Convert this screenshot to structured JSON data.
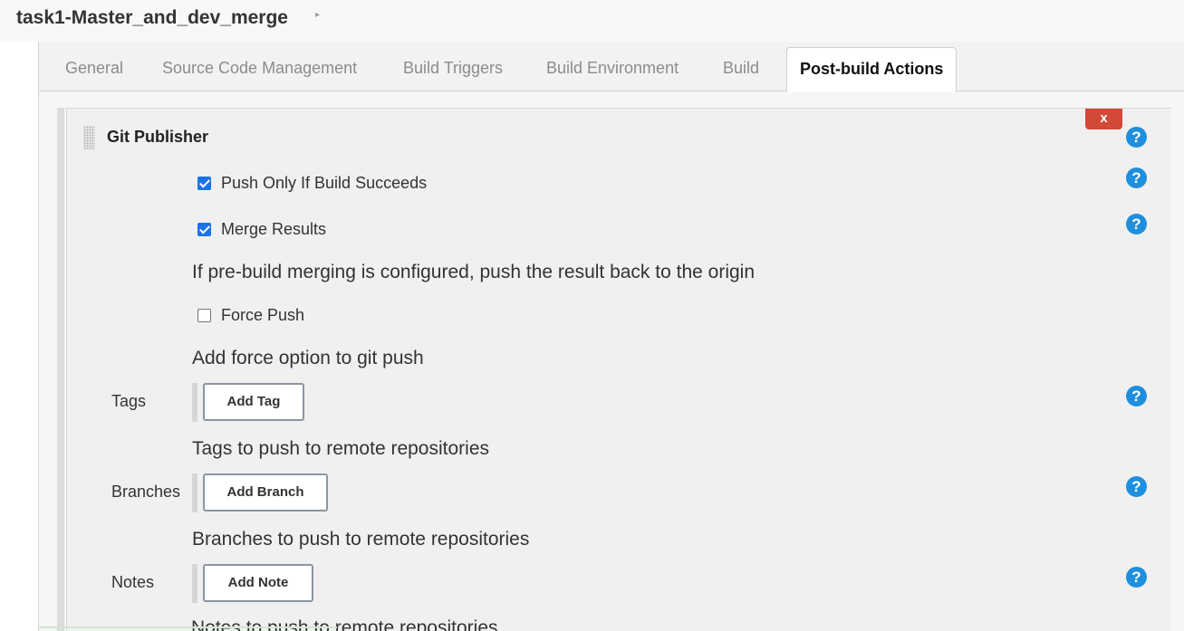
{
  "breadcrumb": {
    "job_name": "task1-Master_and_dev_merge",
    "arrow": "▸"
  },
  "tabs": [
    {
      "label": "General"
    },
    {
      "label": "Source Code Management"
    },
    {
      "label": "Build Triggers"
    },
    {
      "label": "Build Environment"
    },
    {
      "label": "Build"
    },
    {
      "label": "Post-build Actions",
      "active": true
    }
  ],
  "section": {
    "title": "Git Publisher",
    "delete_label": "x",
    "help_label": "?",
    "push_only_if_success": {
      "label": "Push Only If Build Succeeds",
      "checked": true
    },
    "merge_results": {
      "label": "Merge Results",
      "checked": true,
      "description": "If pre-build merging is configured, push the result back to the origin"
    },
    "force_push": {
      "label": "Force Push",
      "checked": false,
      "description": "Add force option to git push"
    },
    "tags": {
      "label": "Tags",
      "button": "Add Tag",
      "description": "Tags to push to remote repositories"
    },
    "branches": {
      "label": "Branches",
      "button": "Add Branch",
      "description": "Branches to push to remote repositories"
    },
    "notes": {
      "label": "Notes",
      "button": "Add Note",
      "description": "Notes to push to remote repositories"
    }
  },
  "colors": {
    "accent": "#1f8fdd",
    "delete": "#d24939",
    "checkbox": "#1a73e8"
  }
}
